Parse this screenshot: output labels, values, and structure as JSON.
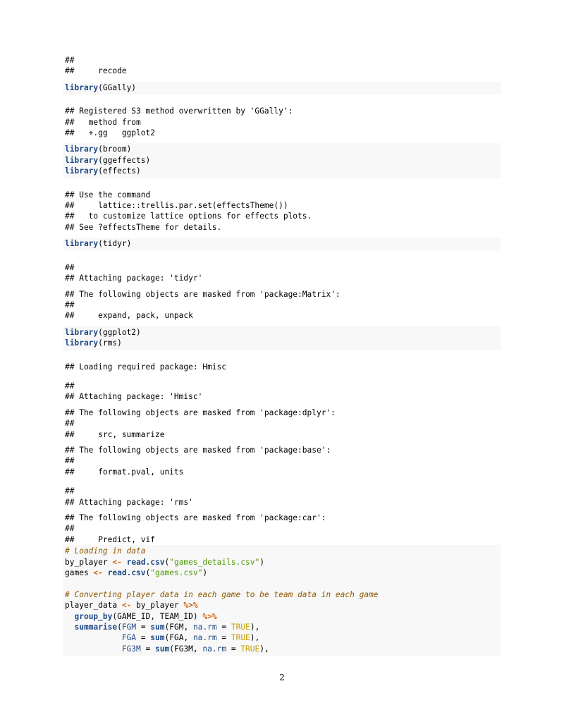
{
  "output_blocks": {
    "o1": [
      "##",
      "##     recode"
    ],
    "o2": [
      "## Registered S3 method overwritten by 'GGally':",
      "##   method from",
      "##   +.gg   ggplot2"
    ],
    "o3": [
      "## Use the command",
      "##     lattice::trellis.par.set(effectsTheme())",
      "##   to customize lattice options for effects plots.",
      "## See ?effectsTheme for details."
    ],
    "o4": [
      "##",
      "## Attaching package: 'tidyr'"
    ],
    "o5": [
      "## The following objects are masked from 'package:Matrix':",
      "##",
      "##     expand, pack, unpack"
    ],
    "o6": [
      "## Loading required package: Hmisc"
    ],
    "o7": [
      "##",
      "## Attaching package: 'Hmisc'"
    ],
    "o8": [
      "## The following objects are masked from 'package:dplyr':",
      "##",
      "##     src, summarize"
    ],
    "o9": [
      "## The following objects are masked from 'package:base':",
      "##",
      "##     format.pval, units"
    ],
    "o10": [
      "##",
      "## Attaching package: 'rms'"
    ],
    "o11": [
      "## The following objects are masked from 'package:car':",
      "##",
      "##     Predict, vif"
    ]
  },
  "code": {
    "library_kw": "library",
    "pkg_ggally": "(GGally)",
    "pkg_broom": "(broom)",
    "pkg_ggeffects": "(ggeffects)",
    "pkg_effects": "(effects)",
    "pkg_tidyr": "(tidyr)",
    "pkg_ggplot2": "(ggplot2)",
    "pkg_rms": "(rms)",
    "comment_load": "# Loading in data",
    "by_player_var": "by_player ",
    "assign": "<-",
    "read_csv": "read.csv",
    "file_details": "\"games_details.csv\"",
    "games_var": "games ",
    "file_games": "\"games.csv\"",
    "comment_convert": "# Converting player data in each game to be team data in each game",
    "player_data_var": "player_data ",
    "by_player_ref": " by_player ",
    "pipe": "%>%",
    "group_by": "group_by",
    "group_args": "(GAME_ID, TEAM_ID) ",
    "summarise": "summarise",
    "sum_fn": "sum",
    "na_rm": "na.rm",
    "true_val": "TRUE",
    "fgm": "FGM",
    "fga": "FGA",
    "fg3m": "FG3M",
    "eq": " = ",
    "comma_sp": ", ",
    "close_comma": "),"
  },
  "footer": {
    "page_number": "2"
  }
}
